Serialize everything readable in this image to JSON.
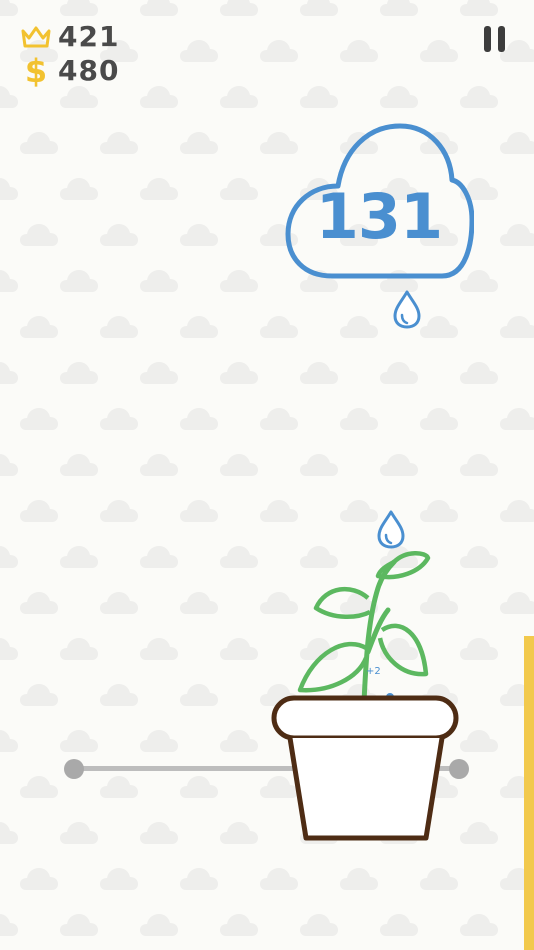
{
  "hud": {
    "best_score": "421",
    "coins": "480",
    "crown_icon": "crown-icon",
    "coin_icon": "dollar-icon",
    "coin_symbol": "$"
  },
  "pause": {
    "icon": "pause-icon"
  },
  "cloud": {
    "counter": "131",
    "color": "#4a8fd0"
  },
  "plant": {
    "splash_text": "+2",
    "stem_color": "#5cb860",
    "pot_color": "#4e2c14"
  },
  "colors": {
    "background": "#fbfbf8",
    "accent_gold": "#f2c230",
    "water_meter": "#f2c94c"
  },
  "water_meter": {
    "level": 0.33
  }
}
